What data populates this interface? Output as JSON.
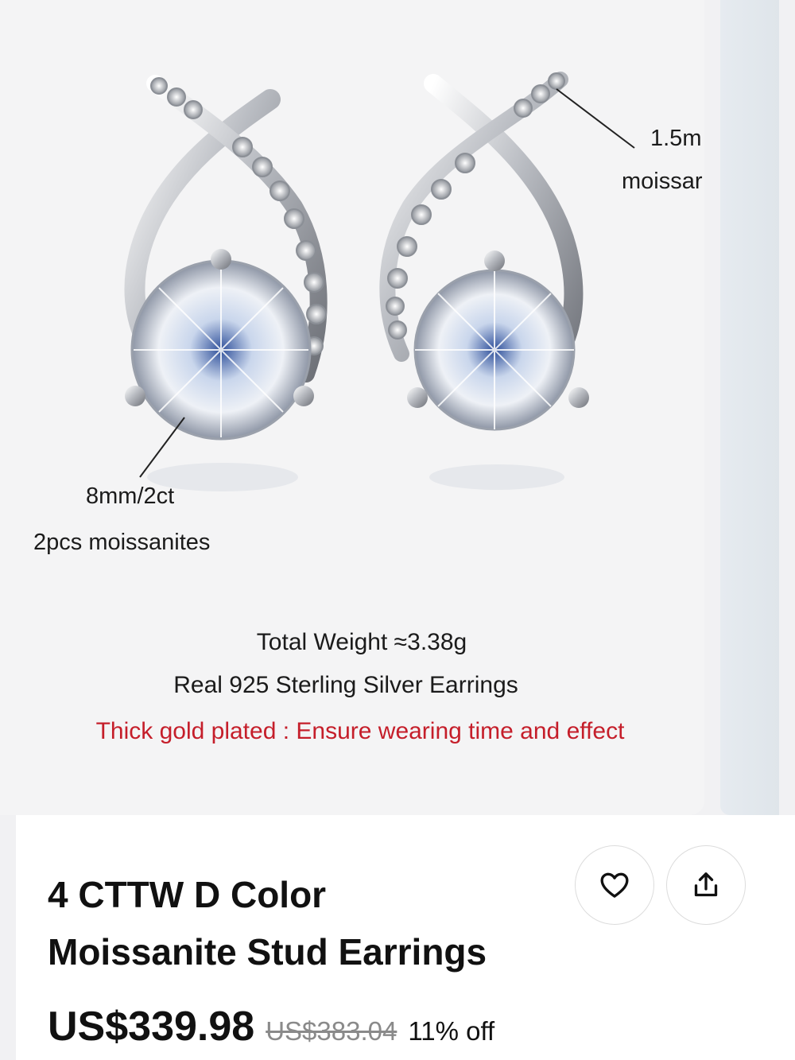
{
  "product_image": {
    "annotations": {
      "small_stone_size": "1.5m",
      "small_stone_type": "moissar",
      "center_stone_size": "8mm/2ct",
      "center_stone_count": "2pcs moissanites"
    },
    "captions": {
      "weight": "Total Weight ≈3.38g",
      "material": "Real 925 Sterling Silver Earrings",
      "plating_note": "Thick gold plated : Ensure wearing time and effect"
    }
  },
  "product": {
    "title_line1": "4 CTTW D Color",
    "title_line2": "Moissanite Stud Earrings",
    "price": "US$339.98",
    "original_price": "US$383.04",
    "discount": "11% off"
  },
  "actions": {
    "wishlist_icon": "heart-icon",
    "share_icon": "share-icon"
  },
  "colors": {
    "accent_red": "#c51e2a",
    "page_bg": "#f1f1f3",
    "panel_bg": "#ffffff"
  }
}
